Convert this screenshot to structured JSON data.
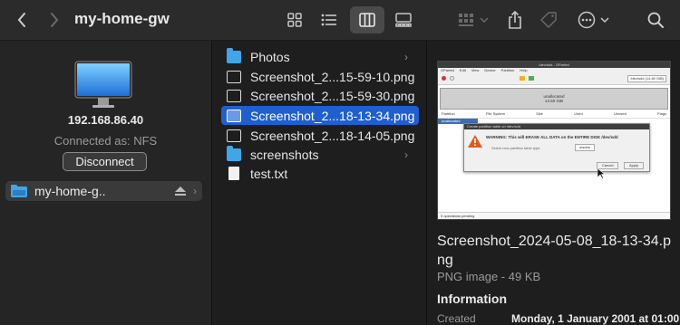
{
  "toolbar": {
    "title": "my-home-gw",
    "back_icon": "chevron-left-icon",
    "forward_icon": "chevron-right-icon",
    "view_icons": [
      "grid-view-icon",
      "list-view-icon",
      "column-view-icon",
      "gallery-view-icon"
    ],
    "group_icon": "group-icon",
    "share_icon": "share-icon",
    "tag_icon": "tag-icon",
    "more_icon": "ellipsis-circle-icon",
    "search_icon": "search-icon"
  },
  "server": {
    "address": "192.168.86.40",
    "connected_as": "Connected as: NFS",
    "disconnect_label": "Disconnect",
    "sidebar_item": "my-home-g.."
  },
  "files": [
    {
      "name": "Photos",
      "type": "folder",
      "chevron": "›"
    },
    {
      "name": "Screenshot_2...15-59-10.png",
      "type": "image"
    },
    {
      "name": "Screenshot_2...15-59-30.png",
      "type": "image"
    },
    {
      "name": "Screenshot_2...18-13-34.png",
      "type": "image",
      "selected": true
    },
    {
      "name": "Screenshot_2...18-14-05.png",
      "type": "image"
    },
    {
      "name": "screenshots",
      "type": "folder",
      "chevron": "›"
    },
    {
      "name": "test.txt",
      "type": "text"
    }
  ],
  "preview": {
    "window_title": "/dev/sdd - GParted",
    "menu": [
      "GParted",
      "Edit",
      "View",
      "Device",
      "Partition",
      "Help"
    ],
    "device": "/dev/sdd (14.60 GiB)",
    "unallocated_label": "unallocated",
    "unallocated_size": "14.60 GiB",
    "columns": [
      "Partition",
      "File System",
      "Size",
      "Used",
      "Unused",
      "Flags"
    ],
    "row_partition": "unallocated",
    "dialog_title": "Create partition table on /dev/sdd",
    "warning": "WARNING: This will ERASE ALL DATA on the ENTIRE DISK /dev/sdd",
    "select_label": "Select new partition table type:",
    "select_value": "msdos",
    "cancel": "Cancel",
    "apply": "Apply",
    "status": "0 operations pending"
  },
  "info": {
    "filename": "Screenshot_2024-05-08_18-13-34.png",
    "kind": "PNG image - 49 KB",
    "section": "Information",
    "created_label": "Created",
    "created_value": "Monday, 1 January 2001 at 01:00"
  }
}
